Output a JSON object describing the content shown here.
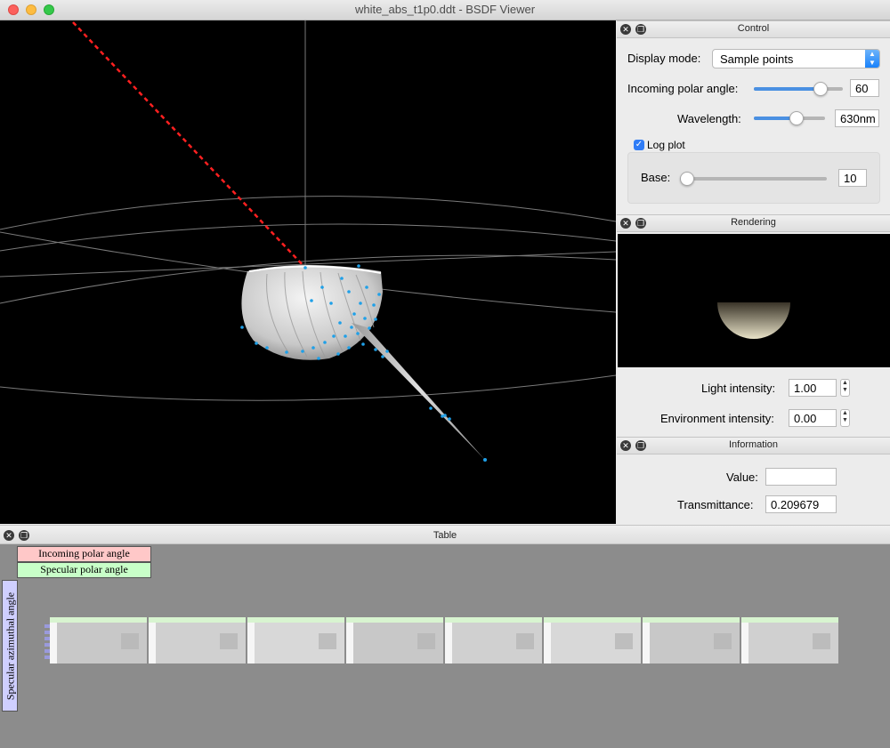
{
  "window": {
    "title": "white_abs_t1p0.ddt - BSDF Viewer"
  },
  "control": {
    "title": "Control",
    "display_mode_label": "Display mode:",
    "display_mode_value": "Sample points",
    "incoming_polar_label": "Incoming polar angle:",
    "incoming_polar_value": "60",
    "incoming_polar_fraction": 0.75,
    "wavelength_label": "Wavelength:",
    "wavelength_value": "630nm",
    "wavelength_fraction": 0.6,
    "log_plot_label": "Log plot",
    "log_plot_checked": true,
    "base_label": "Base:",
    "base_value": "10",
    "base_fraction": 0.05
  },
  "rendering": {
    "title": "Rendering",
    "light_intensity_label": "Light intensity:",
    "light_intensity_value": "1.00",
    "env_intensity_label": "Environment intensity:",
    "env_intensity_value": "0.00"
  },
  "information": {
    "title": "Information",
    "value_label": "Value:",
    "value_value": "",
    "transmittance_label": "Transmittance:",
    "transmittance_value": "0.209679"
  },
  "table": {
    "title": "Table",
    "legend_incoming": "Incoming polar angle",
    "legend_specular_polar": "Specular polar angle",
    "legend_specular_azimuthal": "Specular azimuthal angle",
    "colors": {
      "incoming": "#ffc8c8",
      "specular_polar": "#c8ffc8",
      "azimuthal": "#cfcfff"
    }
  },
  "colors": {
    "accent": "#4a90e2",
    "incident_ray": "#ff2020",
    "sample_point": "#1fa0e8"
  }
}
